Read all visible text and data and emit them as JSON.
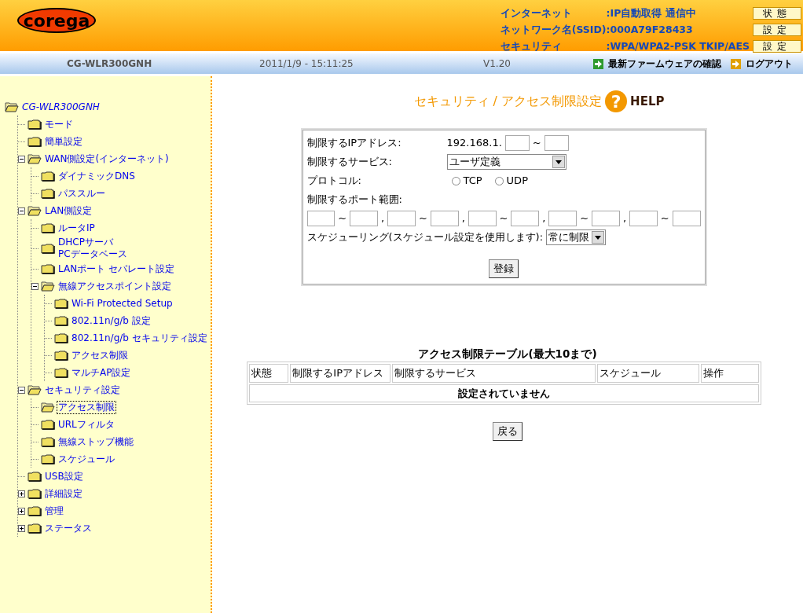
{
  "header": {
    "logo": "corega",
    "status": [
      {
        "label": "インターネット",
        "value": ":IP自動取得 通信中",
        "button": "状態"
      },
      {
        "label": "ネットワーク名(SSID)",
        "value": ":000A79F28433",
        "button": "設定"
      },
      {
        "label": "セキュリティ",
        "value": ":WPA/WPA2-PSK  TKIP/AES",
        "button": "設定"
      }
    ]
  },
  "subbar": {
    "model": "CG-WLR300GNH",
    "datetime": "2011/1/9 - 15:11:25",
    "version": "V1.20",
    "links": [
      {
        "label": "最新ファームウェアの確認",
        "color": "#2e9a2e"
      },
      {
        "label": "ログアウト",
        "color": "#e0a000"
      }
    ]
  },
  "tree": {
    "label": "CG-WLR300GNH",
    "children": [
      {
        "label": "モード",
        "kind": "page",
        "selected": false
      },
      {
        "label": "簡単設定",
        "kind": "page",
        "selected": false
      },
      {
        "label": "WAN側設定(インターネット)",
        "kind": "folder",
        "expanded": true,
        "selected": false,
        "children": [
          {
            "label": "ダイナミックDNS",
            "kind": "page",
            "selected": false
          },
          {
            "label": "パススルー",
            "kind": "page",
            "selected": false
          }
        ]
      },
      {
        "label": "LAN側設定",
        "kind": "folder",
        "expanded": true,
        "selected": false,
        "children": [
          {
            "label": "ルータIP",
            "kind": "page",
            "selected": false
          },
          {
            "label": "DHCPサーバ\nPCデータベース",
            "kind": "page",
            "selected": false
          },
          {
            "label": "LANポート セパレート設定",
            "kind": "page",
            "selected": false
          },
          {
            "label": "無線アクセスポイント設定",
            "kind": "folder",
            "expanded": true,
            "selected": false,
            "children": [
              {
                "label": "Wi-Fi Protected Setup",
                "kind": "page",
                "selected": false
              },
              {
                "label": "802.11n/g/b 設定",
                "kind": "page",
                "selected": false
              },
              {
                "label": "802.11n/g/b セキュリティ設定",
                "kind": "page",
                "selected": false
              },
              {
                "label": "アクセス制限",
                "kind": "page",
                "selected": false
              },
              {
                "label": "マルチAP設定",
                "kind": "page",
                "selected": false
              }
            ]
          }
        ]
      },
      {
        "label": "セキュリティ設定",
        "kind": "folder",
        "expanded": true,
        "selected": false,
        "children": [
          {
            "label": "アクセス制限",
            "kind": "page",
            "selected": true
          },
          {
            "label": "URLフィルタ",
            "kind": "page",
            "selected": false
          },
          {
            "label": "無線ストップ機能",
            "kind": "page",
            "selected": false
          },
          {
            "label": "スケジュール",
            "kind": "page",
            "selected": false
          }
        ]
      },
      {
        "label": "USB設定",
        "kind": "page",
        "selected": false
      },
      {
        "label": "詳細設定",
        "kind": "folder",
        "expanded": false,
        "selected": false
      },
      {
        "label": "管理",
        "kind": "folder",
        "expanded": false,
        "selected": false
      },
      {
        "label": "ステータス",
        "kind": "folder",
        "expanded": false,
        "selected": false
      }
    ]
  },
  "page": {
    "title": "セキュリティ / アクセス制限設定",
    "help_icon": "?",
    "help": "HELP"
  },
  "form": {
    "ip_label": "制限するIPアドレス:",
    "ip_prefix": "192.168.1.",
    "ip_separator": "~",
    "service_label": "制限するサービス:",
    "service_value": "ユーザ定義",
    "protocol_label": "プロトコル:",
    "protocols": [
      {
        "label": "TCP",
        "selected": false
      },
      {
        "label": "UDP",
        "selected": false
      }
    ],
    "port_label": "制限するポート範囲:",
    "port_ranges": [
      {
        "separator": "~",
        "delimiter": ","
      },
      {
        "separator": "~",
        "delimiter": ","
      },
      {
        "separator": "~",
        "delimiter": ","
      },
      {
        "separator": "~",
        "delimiter": ","
      },
      {
        "separator": "~"
      }
    ],
    "schedule_label": "スケジューリング(スケジュール設定を使用します):",
    "schedule_value": "常に制限",
    "submit": "登録"
  },
  "table": {
    "title": "アクセス制限テーブル(最大10まで)",
    "columns": [
      "状態",
      "制限するIPアドレス",
      "制限するサービス",
      "スケジュール",
      "操作"
    ],
    "empty": "設定されていません"
  },
  "back": "戻る"
}
